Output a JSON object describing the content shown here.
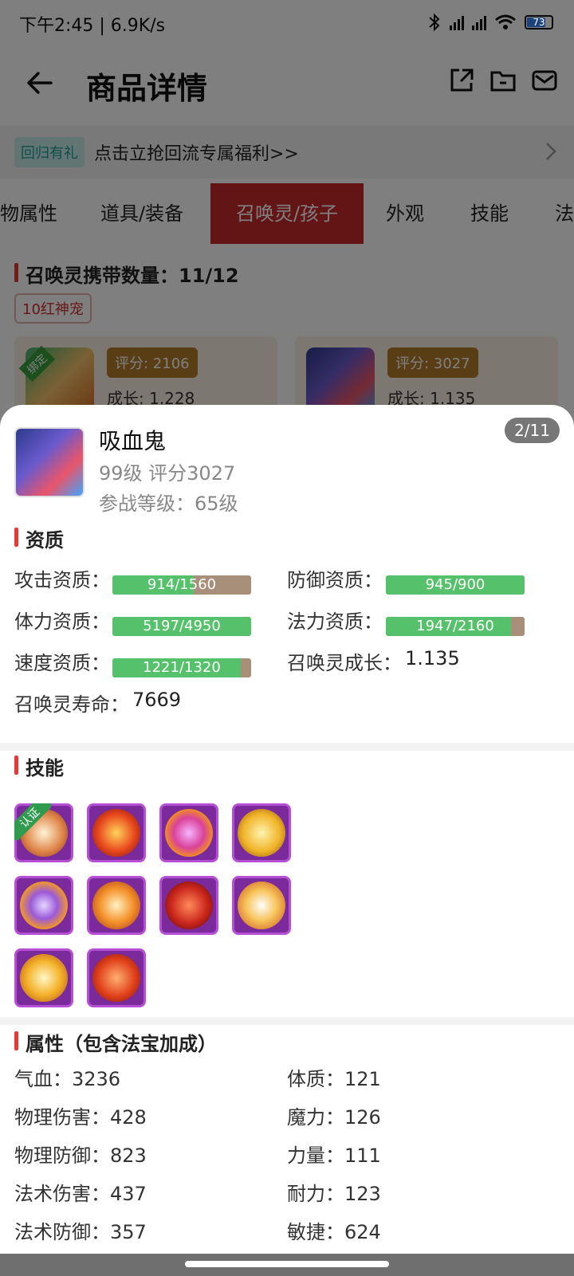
{
  "status_bar": {
    "time_speed": "下午2:45 | 6.9K/s",
    "battery": "73"
  },
  "header": {
    "title": "商品详情"
  },
  "promo": {
    "tag": "回归有礼",
    "text": "点击立抢回流专属福利>>"
  },
  "tabs": [
    {
      "label": "物属性"
    },
    {
      "label": "道具/装备"
    },
    {
      "label": "召唤灵/孩子",
      "active": true
    },
    {
      "label": "外观"
    },
    {
      "label": "技能"
    },
    {
      "label": "法"
    }
  ],
  "pets_section": {
    "heading": "召唤灵携带数量：11/12",
    "tag": "10红神宠",
    "cards": [
      {
        "score": "评分: 2106",
        "growth": "成长: 1.228",
        "badge": "绑定"
      },
      {
        "score": "评分: 3027",
        "growth": "成长: 1.135"
      }
    ]
  },
  "sheet": {
    "name": "吸血鬼",
    "level_score": "99级 评分3027",
    "battle_level": "参战等级：65级",
    "page": "2/11",
    "aptitude_heading": "资质",
    "aptitudes": [
      {
        "label": "攻击资质：",
        "value": "914/1560",
        "ratio": 0.586
      },
      {
        "label": "防御资质：",
        "value": "945/900",
        "ratio": 1.0
      },
      {
        "label": "体力资质：",
        "value": "5197/4950",
        "ratio": 1.0
      },
      {
        "label": "法力资质：",
        "value": "1947/2160",
        "ratio": 0.901
      },
      {
        "label": "速度资质：",
        "value": "1221/1320",
        "ratio": 0.925
      }
    ],
    "growth_label": "召唤灵成长：",
    "growth_value": "1.135",
    "life_label": "召唤灵寿命：",
    "life_value": "7669",
    "skills_heading": "技能",
    "skills": [
      {
        "icon": "certified-skill-icon",
        "cert": "认证"
      },
      {
        "icon": "fire-demon-skill-icon"
      },
      {
        "icon": "lightning-skill-icon"
      },
      {
        "icon": "gold-shield-skill-icon"
      },
      {
        "icon": "vortex-skill-icon"
      },
      {
        "icon": "flame-skill-icon"
      },
      {
        "icon": "red-spirit-skill-icon"
      },
      {
        "icon": "rabbit-skill-icon"
      },
      {
        "icon": "sun-skill-icon"
      },
      {
        "icon": "phoenix-skill-icon"
      }
    ],
    "attrs_heading": "属性（包含法宝加成）",
    "attrs_left": [
      "气血：3236",
      "物理伤害：428",
      "物理防御：823",
      "法术伤害：437",
      "法术防御：357"
    ],
    "attrs_right": [
      "体质：121",
      "魔力：126",
      "力量：111",
      "耐力：123",
      "敏捷：624"
    ]
  }
}
